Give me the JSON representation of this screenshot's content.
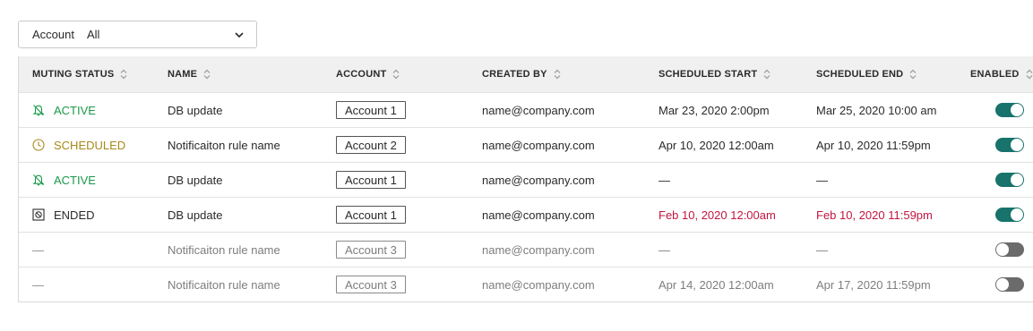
{
  "filter": {
    "label": "Account",
    "value": "All"
  },
  "columns": {
    "status": "MUTING STATUS",
    "name": "NAME",
    "account": "ACCOUNT",
    "created_by": "CREATED BY",
    "scheduled_start": "SCHEDULED START",
    "scheduled_end": "SCHEDULED END",
    "enabled": "ENABLED"
  },
  "rows": [
    {
      "status": "ACTIVE",
      "status_type": "active",
      "name": "DB update",
      "account": "Account 1",
      "created_by": "name@company.com",
      "start": "Mar 23, 2020 2:00pm",
      "end": "Mar 25, 2020 10:00 am",
      "enabled": true
    },
    {
      "status": "SCHEDULED",
      "status_type": "scheduled",
      "name": "Notificaiton rule name",
      "account": "Account 2",
      "created_by": "name@company.com",
      "start": "Apr 10, 2020 12:00am",
      "end": "Apr 10, 2020 11:59pm",
      "enabled": true
    },
    {
      "status": "ACTIVE",
      "status_type": "active",
      "name": "DB update",
      "account": "Account 1",
      "created_by": "name@company.com",
      "start": "—",
      "end": "—",
      "enabled": true
    },
    {
      "status": "ENDED",
      "status_type": "ended",
      "name": "DB update",
      "account": "Account 1",
      "created_by": "name@company.com",
      "start": "Feb 10, 2020 12:00am",
      "end": "Feb 10, 2020 11:59pm",
      "enabled": true
    },
    {
      "status": "—",
      "status_type": "none",
      "name": "Notificaiton rule name",
      "account": "Account 3",
      "created_by": "name@company.com",
      "start": "—",
      "end": "—",
      "enabled": false
    },
    {
      "status": "—",
      "status_type": "none",
      "name": "Notificaiton rule name",
      "account": "Account 3",
      "created_by": "name@company.com",
      "start": "Apr 14, 2020 12:00am",
      "end": "Apr 17, 2020 11:59pm",
      "enabled": false
    }
  ],
  "colors": {
    "active": "#1a9a4a",
    "scheduled": "#a7891a",
    "expired_date": "#c0163f",
    "toggle_on": "#17736b",
    "toggle_off": "#6b6b6b",
    "header_bg": "#f0f0f0"
  },
  "icons": {
    "active": "bell-off-icon",
    "scheduled": "clock-icon",
    "ended": "ended-square-icon",
    "sort": "sort-arrows-icon",
    "dropdown": "chevron-down-icon"
  }
}
